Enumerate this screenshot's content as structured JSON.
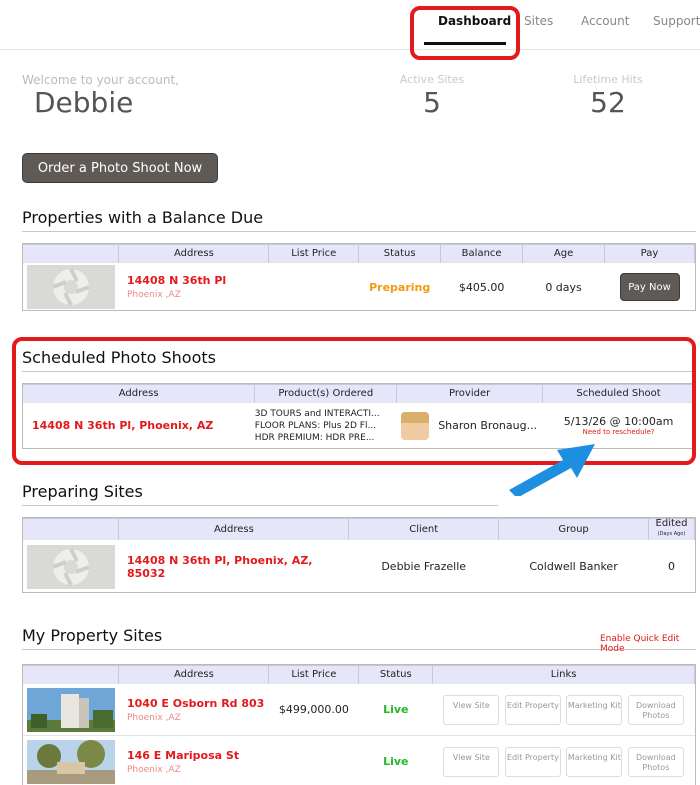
{
  "nav": {
    "dashboard": "Dashboard",
    "sites": "Sites",
    "account": "Account",
    "support": "Support"
  },
  "welcome": {
    "label": "Welcome to your account,",
    "name": "Debbie"
  },
  "stats": {
    "active_sites_label": "Active Sites",
    "active_sites": "5",
    "lifetime_hits_label": "Lifetime Hits",
    "lifetime_hits": "52"
  },
  "order_button": "Order a Photo Shoot Now",
  "balance": {
    "title": "Properties with a Balance Due",
    "headers": [
      "Address",
      "List Price",
      "Status",
      "Balance",
      "Age",
      "Pay"
    ],
    "row": {
      "address": "14408 N 36th Pl",
      "city": "Phoenix ,AZ",
      "price": "",
      "status": "Preparing",
      "balance": "$405.00",
      "age": "0 days",
      "pay": "Pay Now"
    }
  },
  "scheduled": {
    "title": "Scheduled Photo Shoots",
    "headers": [
      "Address",
      "Product(s) Ordered",
      "Provider",
      "Scheduled Shoot"
    ],
    "row": {
      "address": "14408 N 36th Pl, Phoenix, AZ",
      "products": [
        "3D TOURS and INTERACTI...",
        "FLOOR PLANS: Plus 2D Fl...",
        "HDR PREMIUM: HDR PRE..."
      ],
      "provider": "Sharon Bronaug...",
      "shoot": "5/13/26 @ 10:00am",
      "reschedule": "Need to reschedule?"
    }
  },
  "preparing": {
    "title": "Preparing Sites",
    "headers": [
      "Address",
      "Client",
      "Group",
      "Edited",
      "(Days Ago)"
    ],
    "row": {
      "address": "14408 N 36th Pl, Phoenix, AZ, 85032",
      "client": "Debbie Frazelle",
      "group": "Coldwell Banker",
      "edited": "0"
    }
  },
  "my_sites": {
    "title": "My Property Sites",
    "quick_edit": "Enable Quick Edit Mode",
    "headers": [
      "Address",
      "List Price",
      "Status",
      "Links"
    ],
    "rows": [
      {
        "address": "1040 E Osborn Rd 803",
        "city": "Phoenix ,AZ",
        "price": "$499,000.00",
        "status": "Live"
      },
      {
        "address": "146 E Mariposa St",
        "city": "Phoenix ,AZ",
        "price": "",
        "status": "Live"
      }
    ],
    "links": {
      "view": "View Site",
      "edit": "Edit Property",
      "marketing": "Marketing Kit",
      "download": "Download Photos"
    }
  },
  "colors": {
    "accent_red": "#e3191b",
    "header_bg": "#e6e6fb",
    "button": "#5f5a55",
    "live": "#22bb22",
    "preparing": "#f39a11",
    "arrow": "#1e8fe0"
  }
}
